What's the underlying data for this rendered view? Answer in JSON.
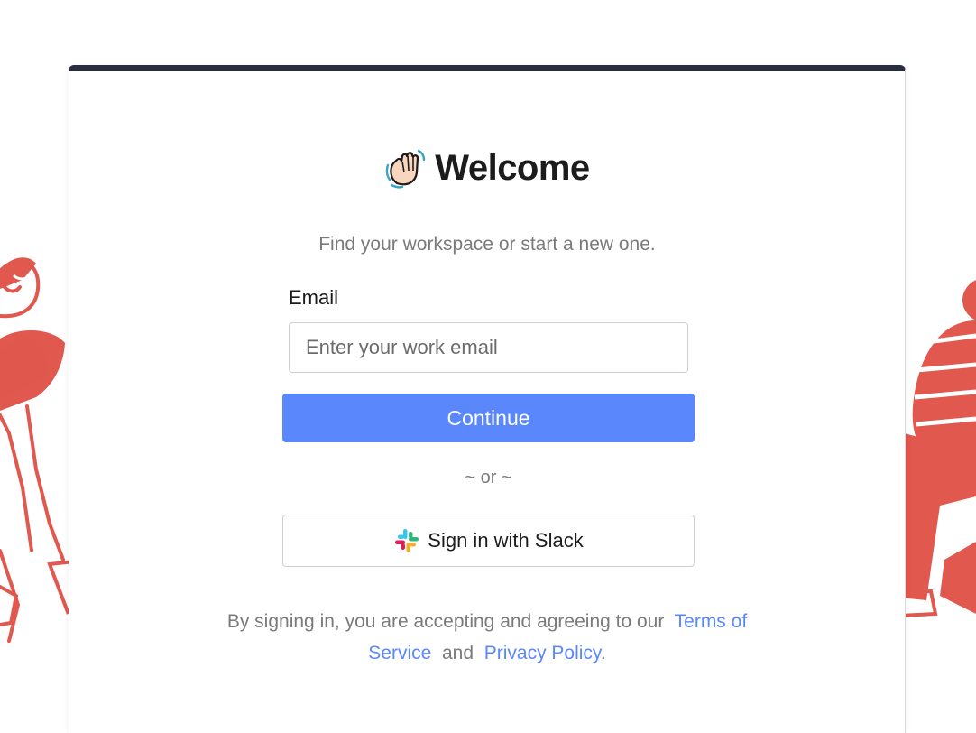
{
  "header": {
    "title": "Welcome",
    "icon": "waving-hand-icon",
    "subtitle": "Find your workspace or start a new one."
  },
  "form": {
    "email_label": "Email",
    "email_placeholder": "Enter your work email",
    "email_value": "",
    "continue_label": "Continue",
    "or_text": "~ or ~",
    "slack_label": "Sign in with Slack",
    "slack_icon": "slack-logo-icon"
  },
  "legal": {
    "prefix": "By signing in, you are accepting and agreeing to our",
    "terms_line1": "Terms of",
    "terms_line2": "Service",
    "and": "and",
    "privacy": "Privacy Policy",
    "suffix": "."
  },
  "colors": {
    "primary": "#5b87fd",
    "card_top_border": "#2a2f3d",
    "illustration": "#e0584e",
    "muted_text": "#7a7a7a"
  }
}
